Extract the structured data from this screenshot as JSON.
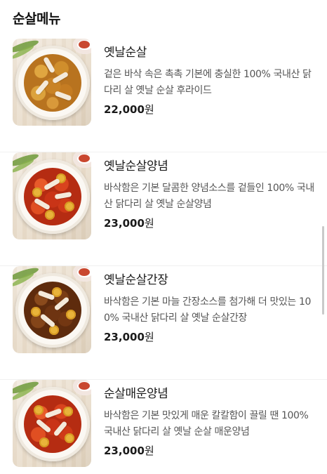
{
  "section": {
    "title": "순살메뉴"
  },
  "colors": {
    "text": "#1a1a1a",
    "description": "#555555",
    "divider": "#f0f0f0"
  },
  "items": [
    {
      "name": "옛날순살",
      "description": "겉은 바삭 속은 촉촉 기본에 충실한 100% 국내산 닭다리 살 옛날 순살 후라이드",
      "price": "22,000",
      "currency": "원",
      "image": "fried-chicken-image"
    },
    {
      "name": "옛날순살양념",
      "description": "바삭함은 기본 달콤한 양념소스를 겉들인 100% 국내산 닭다리 살 옛날 순살양념",
      "price": "23,000",
      "currency": "원",
      "image": "sauced-chicken-image"
    },
    {
      "name": "옛날순살간장",
      "description": "바삭함은 기본 마늘 간장소스를 첨가해 더 맛있는 100% 국내산 닭다리 살 옛날 순살간장",
      "price": "23,000",
      "currency": "원",
      "image": "soy-chicken-image"
    },
    {
      "name": "순살매운양념",
      "description": "바삭함은 기본 맛있게 매운 칼칼함이 끌릴 땐 100% 국내산 닭다리 살 옛날 순살 매운양념",
      "price": "23,000",
      "currency": "원",
      "image": "spicy-chicken-image"
    }
  ]
}
